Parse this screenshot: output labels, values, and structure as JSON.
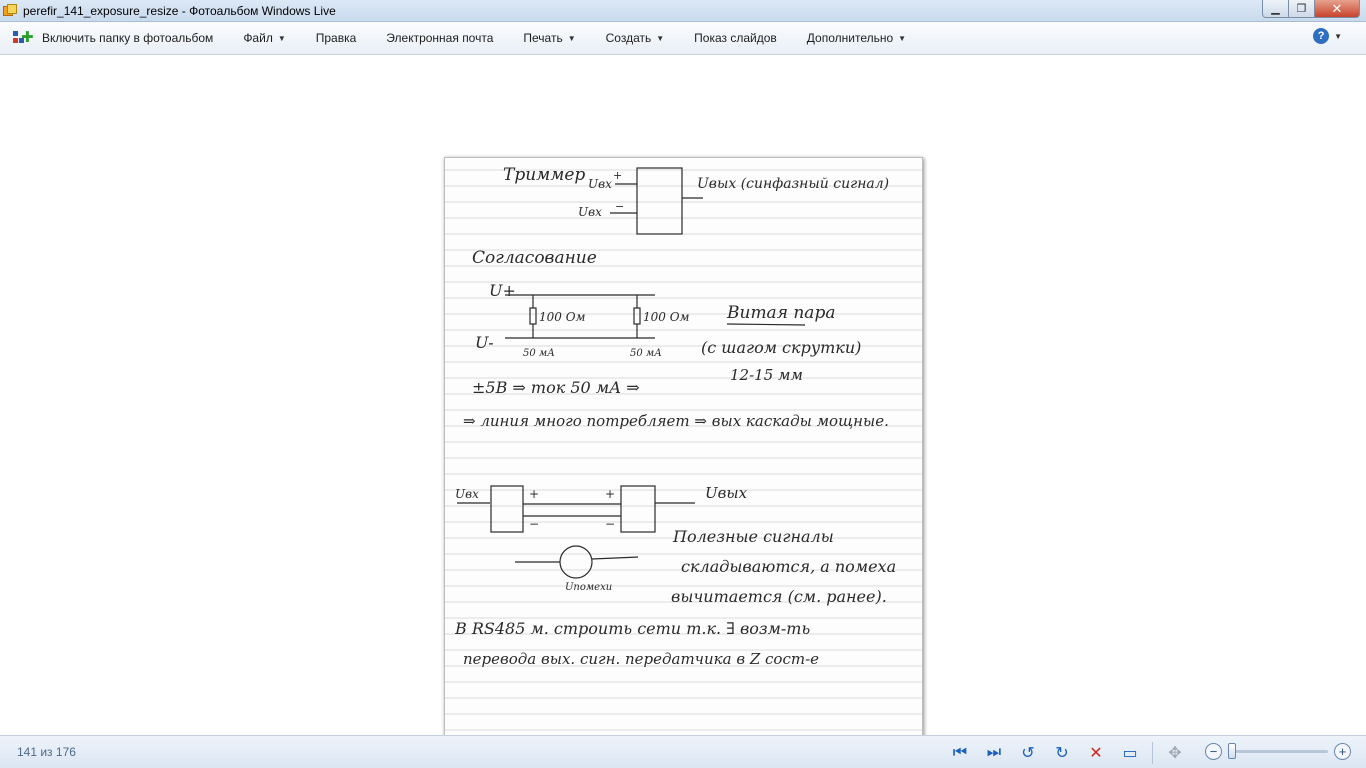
{
  "window": {
    "title": "perefir_141_exposure_resize - Фотоальбом Windows Live",
    "minimize_glyph": "▁",
    "maximize_glyph": "❐",
    "close_glyph": "✕"
  },
  "menu": {
    "include_folder": "Включить папку в фотоальбом",
    "file": "Файл",
    "edit": "Правка",
    "email": "Электронная почта",
    "print": "Печать",
    "create": "Создать",
    "slideshow": "Показ слайдов",
    "extra": "Дополнительно",
    "help_glyph": "?"
  },
  "photo": {
    "notes": {
      "line1": "Триммер",
      "uin_plus": "Uвх",
      "uin_minus": "Uвх",
      "uout": "Uвых (синфазный сигнал)",
      "heading": "Согласование",
      "vplus": "U+",
      "vminus": "U-",
      "r1": "100 Ом",
      "r2": "100 Ом",
      "i1": "50 мА",
      "i2": "50 мА",
      "twisted": "Витая пара",
      "twisted2": "(с шагом скрутки)",
      "twisted3": "12-15 мм",
      "line_5v": "±5В ⇒ ток 50 мА ⇒",
      "line_power": "⇒ линия много потребляет ⇒ вых каскады мощные.",
      "uvx2": "Uвх",
      "uvyx2": "Uвых",
      "noise": "Uпомехи",
      "sub1": "Полезные сигналы",
      "sub2": "складываются, а помеха",
      "sub3": "вычитается (см. ранее).",
      "rs1": "В RS485 м. строить сети т.к. ∃ возм-ть",
      "rs2": "перевода вых. сигн. передатчика в Z сост-е"
    }
  },
  "status": {
    "counter": "141 из 176"
  },
  "controls": {
    "prev_glyph": "⏮",
    "next_glyph": "⏭",
    "rotate_left_glyph": "↺",
    "rotate_right_glyph": "↻",
    "delete_glyph": "✕",
    "slideshow_glyph": "▭",
    "fit_glyph": "✥",
    "zoom_out_glyph": "−",
    "zoom_in_glyph": "+"
  },
  "zoom": {
    "level_fraction": 0.0
  },
  "colors": {
    "accent": "#1a5fbf",
    "delete": "#d0271d",
    "ink": "#2a2a2a"
  }
}
